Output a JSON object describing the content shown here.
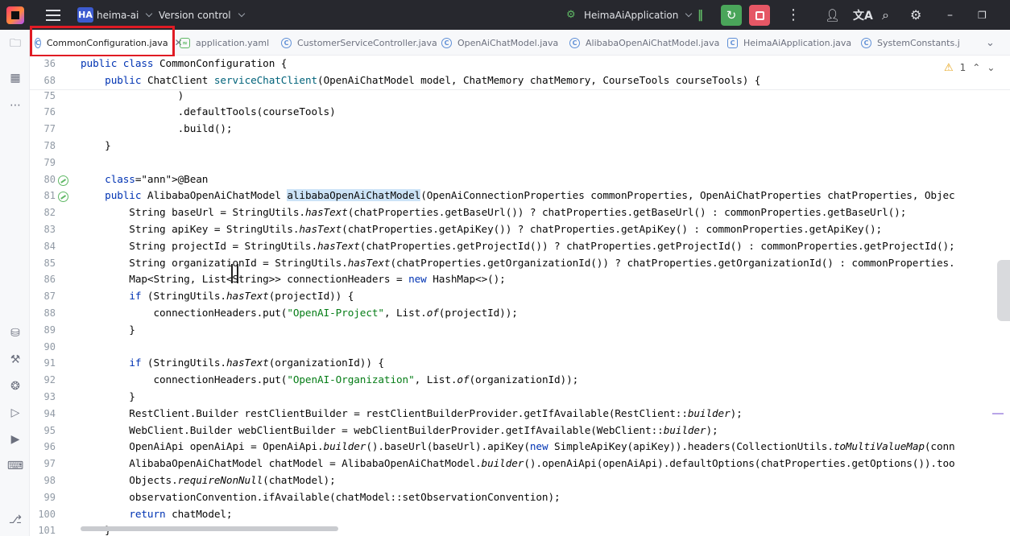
{
  "titlebar": {
    "project_badge": "HA",
    "project_name": "heima-ai",
    "vcs_label": "Version control",
    "run_config": "HeimaAiApplication"
  },
  "tabs": [
    {
      "label": "CommonConfiguration.java",
      "icon": "java-class-icon",
      "active": true
    },
    {
      "label": "application.yaml",
      "icon": "yaml-icon",
      "active": false
    },
    {
      "label": "CustomerServiceController.java",
      "icon": "java-class-icon",
      "active": false
    },
    {
      "label": "OpenAiChatModel.java",
      "icon": "java-class-icon",
      "active": false
    },
    {
      "label": "AlibabaOpenAiChatModel.java",
      "icon": "java-class-icon",
      "active": false
    },
    {
      "label": "HeimaAiApplication.java",
      "icon": "spring-app-icon",
      "active": false
    },
    {
      "label": "SystemConstants.j",
      "icon": "java-class-icon",
      "active": false
    }
  ],
  "inspection": {
    "warnings": "1"
  },
  "sticky": [
    {
      "num": "36",
      "code": "public class CommonConfiguration {"
    },
    {
      "num": "68",
      "code": "    public ChatClient serviceChatClient(OpenAiChatModel model, ChatMemory chatMemory, CourseTools courseTools) {"
    }
  ],
  "lines": [
    {
      "num": "75",
      "code": "                )"
    },
    {
      "num": "76",
      "code": "                .defaultTools(courseTools)"
    },
    {
      "num": "77",
      "code": "                .build();"
    },
    {
      "num": "78",
      "code": "    }"
    },
    {
      "num": "79",
      "code": ""
    },
    {
      "num": "80",
      "code": "    @Bean"
    },
    {
      "num": "81",
      "code": "    public AlibabaOpenAiChatModel alibabaOpenAiChatModel(OpenAiConnectionProperties commonProperties, OpenAiChatProperties chatProperties, Objec"
    },
    {
      "num": "82",
      "code": "        String baseUrl = StringUtils.hasText(chatProperties.getBaseUrl()) ? chatProperties.getBaseUrl() : commonProperties.getBaseUrl();"
    },
    {
      "num": "83",
      "code": "        String apiKey = StringUtils.hasText(chatProperties.getApiKey()) ? chatProperties.getApiKey() : commonProperties.getApiKey();"
    },
    {
      "num": "84",
      "code": "        String projectId = StringUtils.hasText(chatProperties.getProjectId()) ? chatProperties.getProjectId() : commonProperties.getProjectId();"
    },
    {
      "num": "85",
      "code": "        String organizationId = StringUtils.hasText(chatProperties.getOrganizationId()) ? chatProperties.getOrganizationId() : commonProperties."
    },
    {
      "num": "86",
      "code": "        Map<String, List<String>> connectionHeaders = new HashMap<>();"
    },
    {
      "num": "87",
      "code": "        if (StringUtils.hasText(projectId)) {"
    },
    {
      "num": "88",
      "code": "            connectionHeaders.put(\"OpenAI-Project\", List.of(projectId));"
    },
    {
      "num": "89",
      "code": "        }"
    },
    {
      "num": "90",
      "code": ""
    },
    {
      "num": "91",
      "code": "        if (StringUtils.hasText(organizationId)) {"
    },
    {
      "num": "92",
      "code": "            connectionHeaders.put(\"OpenAI-Organization\", List.of(organizationId));"
    },
    {
      "num": "93",
      "code": "        }"
    },
    {
      "num": "94",
      "code": "        RestClient.Builder restClientBuilder = restClientBuilderProvider.getIfAvailable(RestClient::builder);"
    },
    {
      "num": "95",
      "code": "        WebClient.Builder webClientBuilder = webClientBuilderProvider.getIfAvailable(WebClient::builder);"
    },
    {
      "num": "96",
      "code": "        OpenAiApi openAiApi = OpenAiApi.builder().baseUrl(baseUrl).apiKey(new SimpleApiKey(apiKey)).headers(CollectionUtils.toMultiValueMap(conn"
    },
    {
      "num": "97",
      "code": "        AlibabaOpenAiChatModel chatModel = AlibabaOpenAiChatModel.builder().openAiApi(openAiApi).defaultOptions(chatProperties.getOptions()).too"
    },
    {
      "num": "98",
      "code": "        Objects.requireNonNull(chatModel);"
    },
    {
      "num": "99",
      "code": "        observationConvention.ifAvailable(chatModel::setObservationConvention);"
    },
    {
      "num": "100",
      "code": "        return chatModel;"
    },
    {
      "num": "101",
      "code": "    }"
    }
  ],
  "highlight_word": "alibabaOpenAiChatModel",
  "colors": {
    "keyword": "#0033b3",
    "string": "#067d17",
    "annotation": "#9e880d",
    "method_decl": "#00627a",
    "selection": "#cce3f7",
    "active_tab_frame": "#e01b24"
  }
}
